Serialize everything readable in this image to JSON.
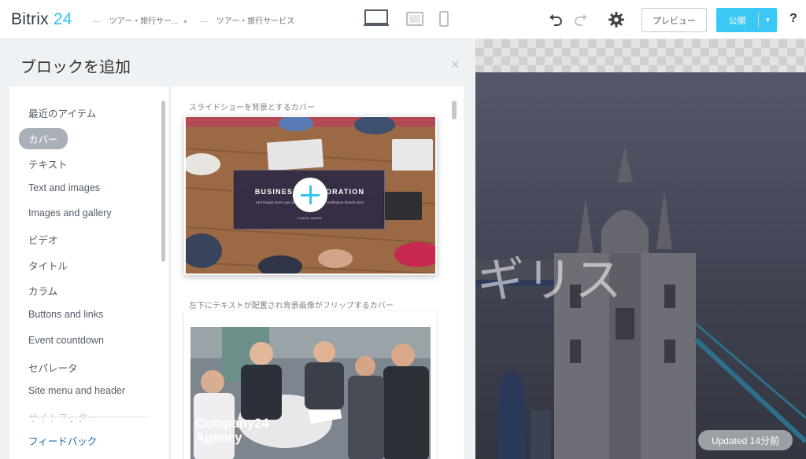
{
  "app": {
    "logo_main": "Bitrix",
    "logo_num": "24"
  },
  "breadcrumbs": [
    {
      "label": "ツアー・旅行サー..."
    },
    {
      "label": "ツアー・旅行サービス"
    }
  ],
  "toolbar": {
    "preview_label": "プレビュー",
    "publish_label": "公開",
    "help_label": "?",
    "publish_color": "#3bc8f5"
  },
  "panel": {
    "title": "ブロックを追加",
    "close_label": "×",
    "categories": [
      "最近のアイテム",
      "カバー",
      "テキスト",
      "Text and images",
      "Images and gallery",
      "ビデオ",
      "タイトル",
      "カラム",
      "Buttons and links",
      "Event countdown",
      "セパレータ",
      "Site menu and header",
      "サイトフッター"
    ],
    "active_category": "カバー",
    "feedback": "フィードバック"
  },
  "blocks": [
    {
      "label": "スライドショーを背景とするカバー",
      "thumb_title": "BUSINESS CORPORATION",
      "thumb_sub": "Sed feugiat lorem quis diam dignissim ipsum vestibulum blandit dolor",
      "thumb_link": "LEARN MORE"
    },
    {
      "label": "左下にテキストが配置され背景画像がフリップするカバー",
      "thumb_title": "Company24\nAgency"
    }
  ],
  "preview": {
    "hero_text": "ギリス",
    "updated": "Updated 14分前"
  }
}
